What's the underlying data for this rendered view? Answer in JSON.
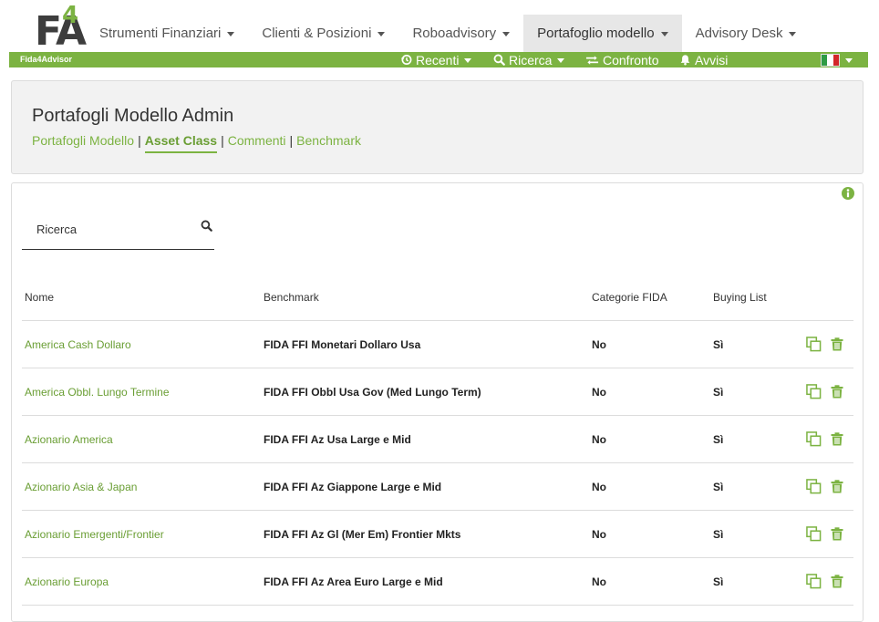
{
  "logo": {
    "main": "FA",
    "accent": "4"
  },
  "nav": {
    "items": [
      {
        "label": "Strumenti Finanziari"
      },
      {
        "label": "Clienti & Posizioni"
      },
      {
        "label": "Roboadvisory"
      },
      {
        "label": "Portafoglio modello"
      },
      {
        "label": "Advisory Desk"
      }
    ],
    "active_index": 3
  },
  "greenbar": {
    "brand": "Fida4Advisor",
    "recenti": "Recenti",
    "ricerca": "Ricerca",
    "confronto": "Confronto",
    "avvisi": "Avvisi",
    "language_icon": "italy-flag-icon"
  },
  "header": {
    "title": "Portafogli Modello Admin",
    "tabs": [
      {
        "label": "Portafogli Modello"
      },
      {
        "label": "Asset Class"
      },
      {
        "label": "Commenti"
      },
      {
        "label": "Benchmark"
      }
    ],
    "active_tab": "Asset Class"
  },
  "search": {
    "placeholder": "Ricerca",
    "value": ""
  },
  "table": {
    "columns": [
      "Nome",
      "Benchmark",
      "Categorie FIDA",
      "Buying List"
    ],
    "rows": [
      {
        "nome": "America Cash Dollaro",
        "benchmark": "FIDA FFI Monetari Dollaro Usa",
        "categorie": "No",
        "buying": "Sì"
      },
      {
        "nome": "America Obbl. Lungo Termine",
        "benchmark": "FIDA FFI Obbl Usa Gov (Med Lungo Term)",
        "categorie": "No",
        "buying": "Sì"
      },
      {
        "nome": "Azionario America",
        "benchmark": "FIDA FFI Az Usa Large e Mid",
        "categorie": "No",
        "buying": "Sì"
      },
      {
        "nome": "Azionario Asia & Japan",
        "benchmark": "FIDA FFI Az Giappone Large e Mid",
        "categorie": "No",
        "buying": "Sì"
      },
      {
        "nome": "Azionario Emergenti/Frontier",
        "benchmark": "FIDA FFI Az Gl (Mer Em) Frontier Mkts",
        "categorie": "No",
        "buying": "Sì"
      },
      {
        "nome": "Azionario Europa",
        "benchmark": "FIDA FFI Az Area Euro Large e Mid",
        "categorie": "No",
        "buying": "Sì"
      }
    ]
  },
  "colors": {
    "accent": "#7cb342",
    "accent_dark": "#6a9e34"
  }
}
